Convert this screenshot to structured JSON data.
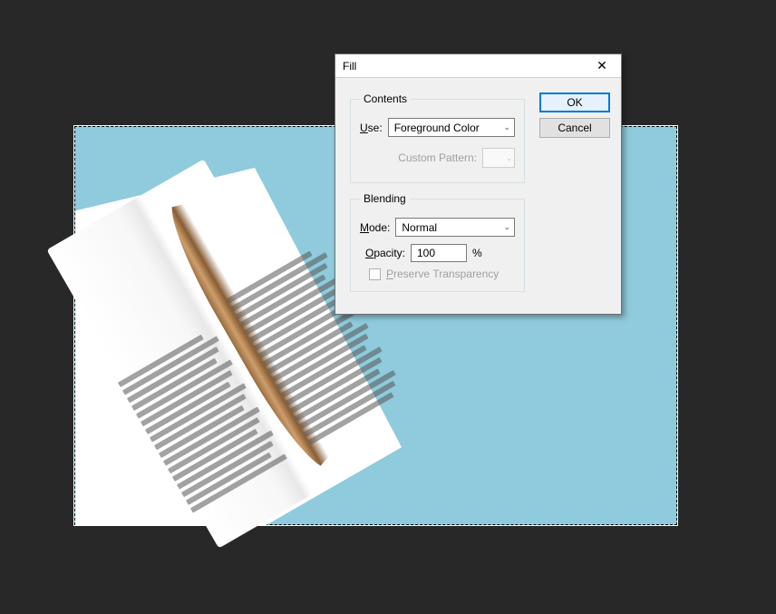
{
  "dialog": {
    "title": "Fill",
    "buttons": {
      "ok": "OK",
      "cancel": "Cancel"
    },
    "contents": {
      "legend": "Contents",
      "use_label": "Use:",
      "use_value": "Foreground Color",
      "pattern_label": "Custom Pattern:"
    },
    "blending": {
      "legend": "Blending",
      "mode_label": "Mode:",
      "mode_value": "Normal",
      "opacity_label": "Opacity:",
      "opacity_value": "100",
      "opacity_unit": "%",
      "preserve_label": "Preserve Transparency"
    }
  }
}
